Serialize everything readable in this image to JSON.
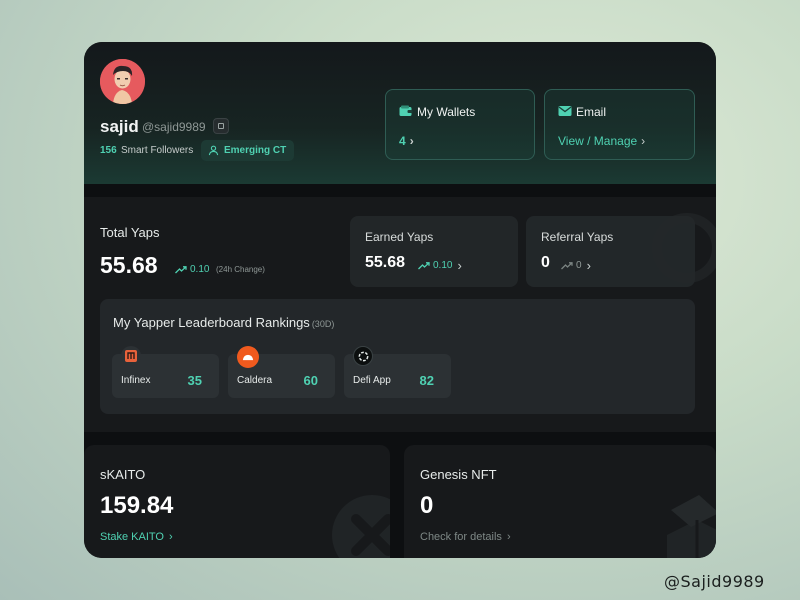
{
  "profile": {
    "name": "sajid",
    "handle": "@sajid9989",
    "followers_count": "156",
    "followers_label": "Smart Followers",
    "badge_label": "Emerging CT",
    "wallets": {
      "title": "My Wallets",
      "value": "4"
    },
    "email": {
      "title": "Email",
      "link": "View / Manage"
    }
  },
  "yaps": {
    "total_label": "Total Yaps",
    "total_value": "55.68",
    "total_change": "0.10",
    "change_note": "(24h Change)",
    "earned": {
      "label": "Earned Yaps",
      "value": "55.68",
      "change": "0.10"
    },
    "referral": {
      "label": "Referral Yaps",
      "value": "0",
      "change": "0"
    }
  },
  "leaderboard": {
    "title": "My Yapper Leaderboard Rankings",
    "period": "(30D)",
    "items": [
      {
        "name": "Infinex",
        "score": "35",
        "logo_color": "#e8623b"
      },
      {
        "name": "Caldera",
        "score": "60",
        "logo_color": "#f05a1e"
      },
      {
        "name": "Defi App",
        "score": "82",
        "logo_color": "#1f2a2a"
      }
    ]
  },
  "skaito": {
    "label": "sKAITO",
    "value": "159.84",
    "link": "Stake KAITO"
  },
  "genesis": {
    "label": "Genesis NFT",
    "value": "0",
    "link": "Check for details"
  },
  "watermark": "@Sajid9989",
  "colors": {
    "accent": "#4fd1b2",
    "card_bg": "#0d0f11",
    "panel_bg": "#17191b"
  }
}
